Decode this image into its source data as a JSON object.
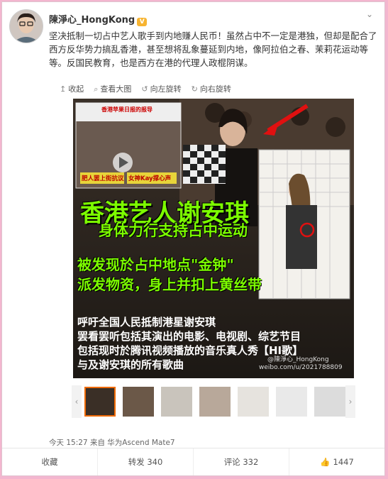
{
  "author": {
    "name": "陳淨心_HongKong",
    "vip_badge": "V"
  },
  "post": {
    "text": "坚决抵制一切占中艺人歌手到内地赚人民币！虽然占中不一定是港独，但却是配合了西方反华势力搞乱香港，甚至想将乱象蔓延到内地，像阿拉伯之春、茉莉花运动等等。反国民教育，也是西方在港的代理人政棍阴谋。",
    "time": "今天 15:27",
    "source": "来自 华为Ascend Mate7"
  },
  "toolbar": {
    "collapse": "收起",
    "view_large": "查看大图",
    "rotate_left": "向左旋转",
    "rotate_right": "向右旋转"
  },
  "image": {
    "headline": "香港艺人谢安琪",
    "subhead": "身体力行支持占中运动",
    "line1": "被发现於占中地点\"金钟\"",
    "line2": "派发物资，身上并扣上黄丝带",
    "line3": "呼吁全国人民抵制港星谢安琪",
    "line4": "罢看罢听包括其演出的电影、电视剧、综艺节目",
    "line5": "包括现时於腾讯视频播放的音乐真人秀【HI歌】",
    "line6": "与及谢安琪的所有歌曲",
    "watermark": "@陳淨心_HongKong",
    "watermark_url": "weibo.com/u/2021788809",
    "inset_title": "香港苹果日报的报导",
    "inset_caption": "肥人罢上街抗议",
    "inset_caption2": "女神Kay撑心声"
  },
  "actions": {
    "favorite": "收藏",
    "repost": "转发 340",
    "comment": "评论 332",
    "like": "1447"
  },
  "colors": {
    "background": "#f3b6cf",
    "headline": "#7CFC00",
    "accent": "#f06a00"
  }
}
